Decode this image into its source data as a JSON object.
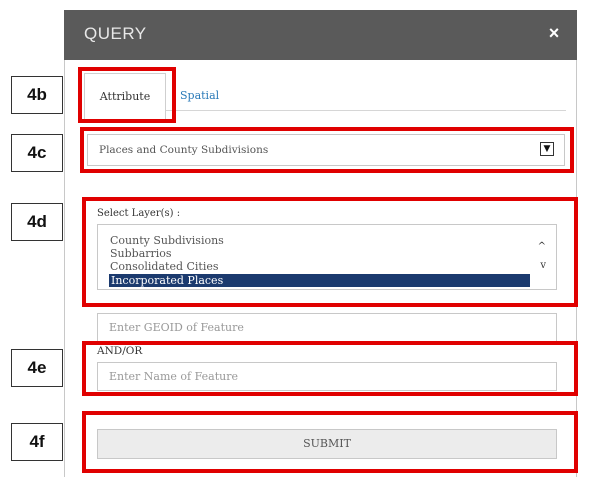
{
  "dialog": {
    "title": "QUERY",
    "close_label": "×"
  },
  "tabs": [
    {
      "label": "Attribute",
      "active": true
    },
    {
      "label": "Spatial",
      "active": false
    }
  ],
  "category_select": {
    "value": "Places and County Subdivisions"
  },
  "layers": {
    "label": "Select Layer(s) :",
    "options": [
      "County Subdivisions",
      "Subbarrios",
      "Consolidated Cities",
      "Incorporated Places"
    ],
    "selected": "Incorporated Places"
  },
  "geoid_field": {
    "placeholder": "Enter GEOID of Feature"
  },
  "andor_label": "AND/OR",
  "name_field": {
    "placeholder": "Enter Name of Feature"
  },
  "submit_label": "SUBMIT",
  "step_labels": [
    "4b",
    "4c",
    "4d",
    "4e",
    "4f"
  ],
  "colors": {
    "header": "#5a5a5a",
    "highlight": "#e00000",
    "selected_option": "#1b3a6e",
    "link": "#2a7ab8"
  }
}
